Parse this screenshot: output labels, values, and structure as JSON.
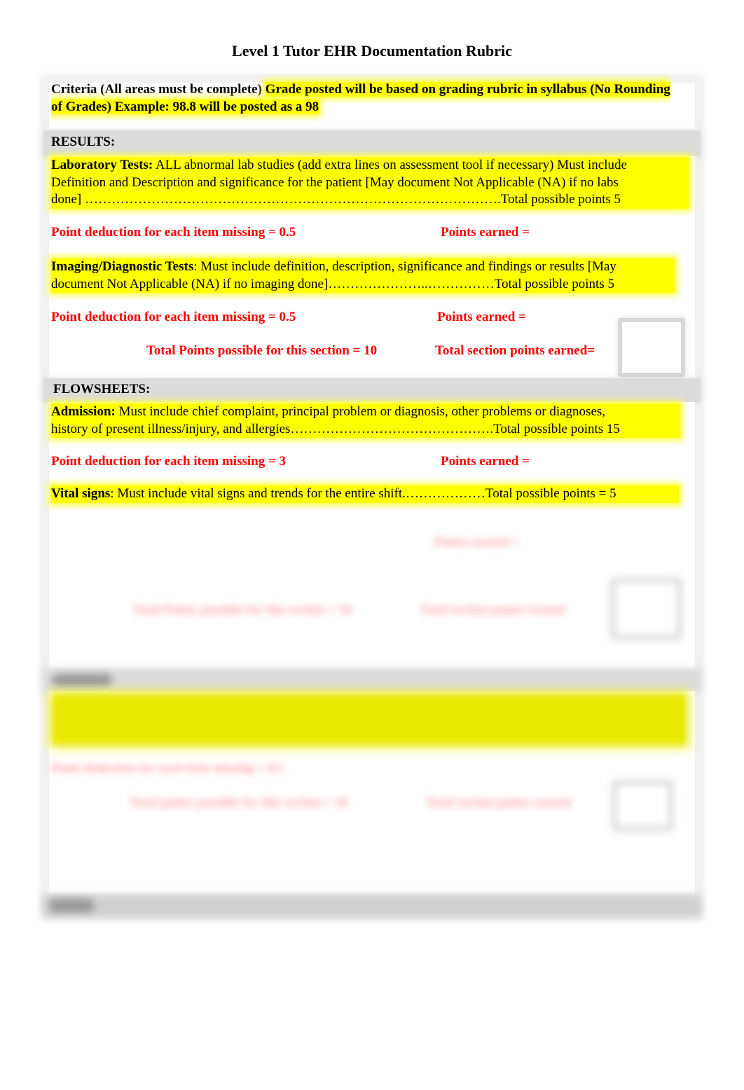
{
  "document": {
    "title": "Level 1 Tutor EHR Documentation Rubric"
  },
  "criteria": {
    "label": "Criteria (All areas must be complete)",
    "note": "Grade posted will be based on grading rubric in syllabus (No Rounding of Grades) Example: 98.8 will be posted as a 98"
  },
  "sections": [
    {
      "header": "RESULTS:",
      "items": [
        {
          "name": "Laboratory Tests:",
          "description_line1": " ALL abnormal lab studies (add extra lines on assessment tool if necessary) Must include",
          "description_line2": "Definition and Description and significance for the patient [May document Not Applicable (NA) if no labs",
          "description_line3": "done] ………………………………………………………………………………….Total possible points 5",
          "deduction": "Point deduction for each item missing  = 0.5",
          "earned": "Points earned  ="
        },
        {
          "name": "Imaging/Diagnostic Tests",
          "description_line1": ": Must include definition, description, significance and findings or results [May",
          "description_line2": "document Not Applicable (NA) if no imaging done]…………………..……………Total possible points 5",
          "deduction": "Point deduction for each item missing = 0.5",
          "earned": "Points earned ="
        }
      ],
      "total_possible": "Total Points possible for this section = 10",
      "total_earned": "Total section points earned="
    },
    {
      "header": "FLOWSHEETS:",
      "items": [
        {
          "name": "Admission:",
          "description_line1": " Must include chief complaint, principal problem or diagnosis, other problems or diagnoses,",
          "description_line2": "history of present illness/injury, and allergies……………………………………….Total possible points 15",
          "deduction": "Point deduction for each item missing  = 3",
          "earned": "Points earned  ="
        },
        {
          "name": "Vital signs",
          "description_line1": ":  Must include vital signs and trends for the entire shift.………………Total possible points = 5",
          "earned_blurred": "Points earned ="
        }
      ],
      "total_possible_blurred": "Total Points possible for this section = 10",
      "total_earned_blurred": "Total section points earned"
    },
    {
      "header_blurred": "ORDERS:",
      "deduction_blurred": "Point deduction for each item missing = 0.5",
      "total_possible_blurred": "Total points possible for this section = 10",
      "total_earned_blurred": "Total section points earned"
    },
    {
      "header_blurred": "MAR:"
    }
  ]
}
